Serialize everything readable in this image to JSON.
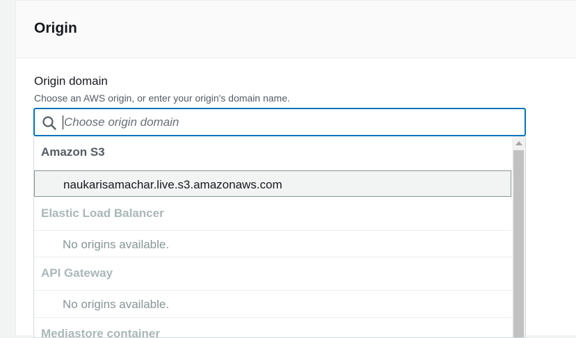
{
  "panel": {
    "title": "Origin"
  },
  "origin_domain": {
    "label": "Origin domain",
    "description": "Choose an AWS origin, or enter your origin's domain name.",
    "placeholder": "Choose origin domain",
    "value": ""
  },
  "dropdown": {
    "groups": [
      {
        "header": "Amazon S3",
        "options": [
          "naukarisamachar.live.s3.amazonaws.com"
        ]
      },
      {
        "header": "Elastic Load Balancer",
        "options": [
          "No origins available."
        ]
      },
      {
        "header": "API Gateway",
        "options": [
          "No origins available."
        ]
      },
      {
        "header": "Mediastore container",
        "options": []
      }
    ]
  },
  "colors": {
    "focus_border": "#0073bb",
    "disabled_text": "#aab7b8",
    "selected_bg": "#f2f3f3"
  },
  "icons": {
    "search": "search-icon",
    "scroll_up": "scroll-up-arrow-icon"
  }
}
